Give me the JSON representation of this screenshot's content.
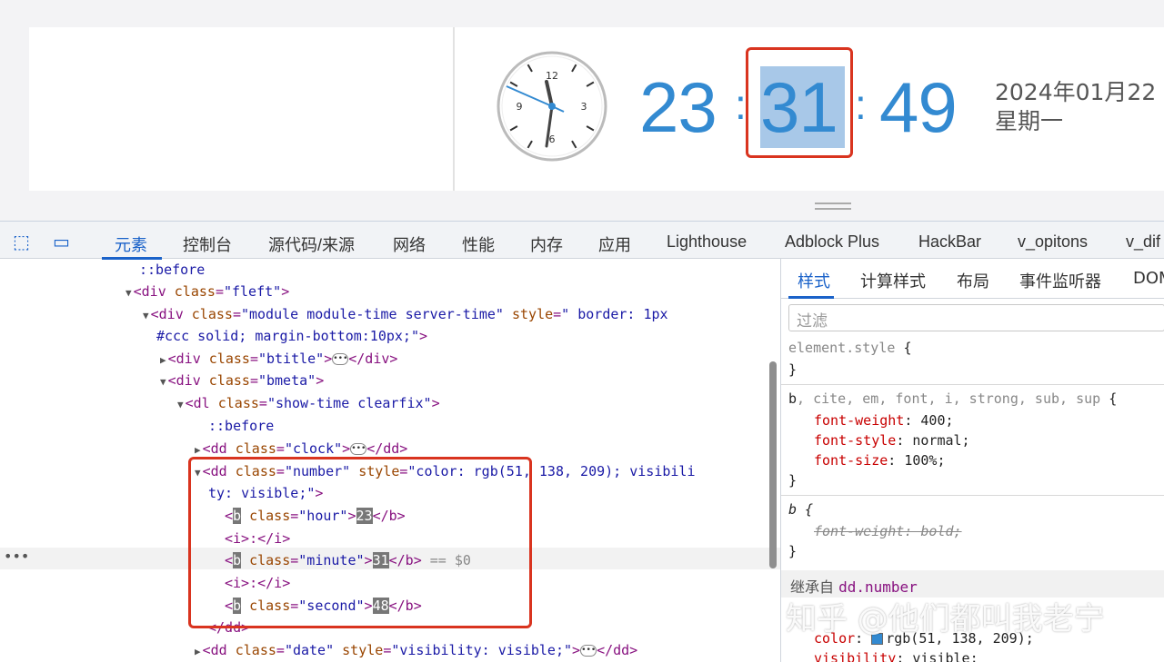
{
  "preview": {
    "hour": "23",
    "minute": "31",
    "second": "49",
    "colon": ":",
    "date": "2024年01月22",
    "weekday": "星期一"
  },
  "clock": {
    "numbers": [
      "12",
      "3",
      "6",
      "9"
    ]
  },
  "devtools": {
    "tabs": [
      "元素",
      "控制台",
      "源代码/来源",
      "网络",
      "性能",
      "内存",
      "应用",
      "Lighthouse",
      "Adblock Plus",
      "HackBar",
      "v_opitons",
      "v_dif"
    ],
    "active_tab": "元素",
    "selected_marker": "== $0",
    "side_tabs": [
      "样式",
      "计算样式",
      "布局",
      "事件监听器",
      "DOM"
    ],
    "filter_placeholder": "过滤",
    "styles": {
      "element_style": "element.style",
      "brace_open": "{",
      "brace_close": "}",
      "rule1_selector": "b, cite, em, font, i, strong, sub, sup",
      "rule1_props": [
        {
          "name": "font-weight",
          "value": "400;"
        },
        {
          "name": "font-style",
          "value": "normal;"
        },
        {
          "name": "font-size",
          "value": "100%;"
        }
      ],
      "rule2_selector": "b",
      "rule2_prop": "font-weight: bold;",
      "inherited_label": "继承自",
      "inherited_from": "dd.number",
      "inh_props": [
        {
          "name": "color",
          "value": "rgb(51, 138, 209);"
        },
        {
          "name": "visibility",
          "value": "visible;"
        }
      ]
    }
  },
  "watermark": "知乎 @他们都叫我老宁",
  "colors": {
    "accent": "#338ad1",
    "highlight_box": "#d9341f",
    "devtools_blue": "#1a62c9"
  }
}
